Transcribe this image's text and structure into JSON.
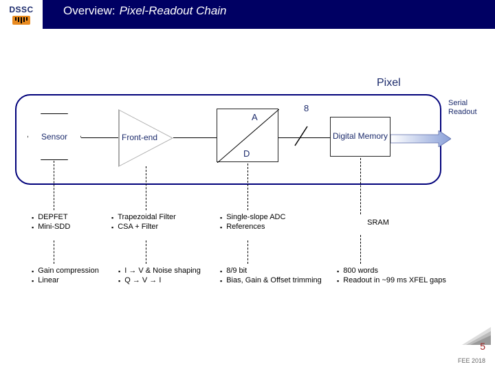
{
  "header": {
    "logo_text": "DSSC",
    "title_prefix": "Overview:",
    "title_emph": "Pixel-Readout Chain"
  },
  "pixel_label": "Pixel",
  "blocks": {
    "sensor": "Sensor",
    "frontend": "Front-end",
    "adc_a": "A",
    "adc_d": "D",
    "bus_width": "8",
    "memory": "Digital Memory",
    "serial_out": "Serial Readout"
  },
  "cols": {
    "sensor_r1": [
      "DEPFET",
      "Mini-SDD"
    ],
    "sensor_r2": [
      "Gain compression",
      "Linear"
    ],
    "fe_r1": [
      "Trapezoidal Filter",
      "CSA + Filter"
    ],
    "fe_r2": [
      "I → V & Noise shaping",
      "Q → V → I"
    ],
    "adc_r1": [
      "Single-slope ADC",
      "References"
    ],
    "adc_r2": [
      "8/9 bit",
      "Bias, Gain & Offset trimming"
    ],
    "mem_r1_note": "SRAM",
    "mem_r2": [
      "800 words",
      "Readout in ~99 ms XFEL gaps"
    ]
  },
  "footer": {
    "page": "5",
    "tag": "FEE 2018"
  }
}
